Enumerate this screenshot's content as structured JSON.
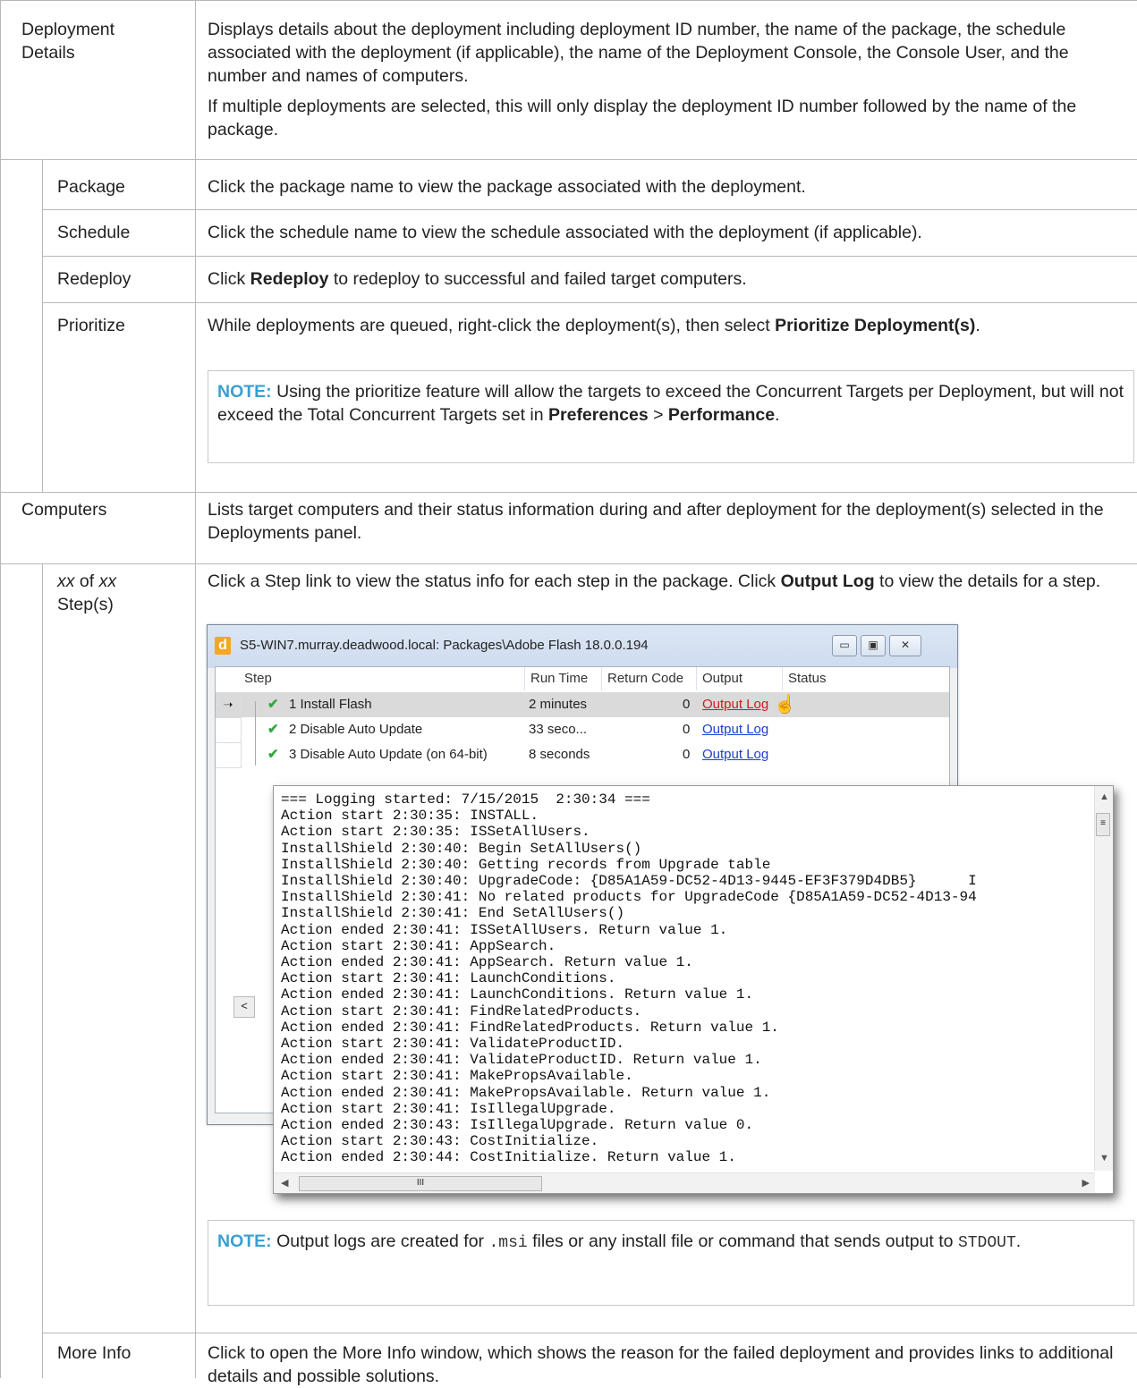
{
  "rows": {
    "deployment_details": {
      "label_line1": "Deployment",
      "label_line2": "Details",
      "para1": "Displays details about the deployment including deployment ID number, the name of the package, the schedule associated with the deployment (if applicable), the name of the Deployment Console, the Console User, and the number and names of computers.",
      "para2": "If multiple deployments are selected, this will only display the deployment ID number followed by the name of the package."
    },
    "package": {
      "label": "Package",
      "text": "Click the package name to view the package associated with the deployment."
    },
    "schedule": {
      "label": "Schedule",
      "text": "Click the schedule name to view the schedule associated with the deployment (if applicable)."
    },
    "redeploy": {
      "label": "Redeploy",
      "text_pre": "Click ",
      "text_bold": "Redeploy",
      "text_post": " to redeploy to successful and failed target computers."
    },
    "prioritize": {
      "label": "Prioritize",
      "text_pre": "While deployments are queued, right-click the deployment(s), then select ",
      "text_bold": "Prioritize Deployment(s)",
      "text_post": ".",
      "note_tag": "NOTE:",
      "note_text": " Using the prioritize feature will allow the targets to exceed the Concurrent Targets per Deployment, but will not exceed the Total Concurrent Targets set in ",
      "note_bold1": "Preferences",
      "note_sep": " > ",
      "note_bold2": "Performance",
      "note_end": "."
    },
    "computers": {
      "label": "Computers",
      "text": "Lists target computers and their status information during and after deployment for the deployment(s) selected in the Deployments panel."
    },
    "steps": {
      "label_xx1": "xx",
      "label_of": " of ",
      "label_xx2": "xx",
      "label_line2": "Step(s)",
      "text_pre": "Click a Step link to view the status info for each step in the package. Click ",
      "text_bold": "Output Log",
      "text_post": " to view the details for a step.",
      "note_tag": "NOTE:",
      "note_text1": " Output logs are created for ",
      "note_code1": ".msi",
      "note_text2": " files or any install file or command that sends output to ",
      "note_code2": "STDOUT",
      "note_end": "."
    },
    "more_info": {
      "label": "More Info",
      "text": "Click to open the More Info window, which shows the reason for the failed deployment and provides links to additional details and possible solutions."
    }
  },
  "window": {
    "title": "S5-WIN7.murray.deadwood.local: Packages\\Adobe Flash 18.0.0.194",
    "logo_letter": "d",
    "columns": [
      "Step",
      "Run Time",
      "Return Code",
      "Output",
      "Status"
    ],
    "steps": [
      {
        "name": "1 Install Flash",
        "run_time": "2 minutes",
        "return_code": "0",
        "output": "Output Log"
      },
      {
        "name": "2 Disable Auto Update",
        "run_time": "33 seco...",
        "return_code": "0",
        "output": "Output Log"
      },
      {
        "name": "3 Disable Auto Update (on 64-bit)",
        "run_time": "8 seconds",
        "return_code": "0",
        "output": "Output Log"
      }
    ]
  },
  "log": {
    "lines": [
      "=== Logging started: 7/15/2015  2:30:34 ===",
      "Action start 2:30:35: INSTALL.",
      "Action start 2:30:35: ISSetAllUsers.",
      "InstallShield 2:30:40: Begin SetAllUsers()",
      "InstallShield 2:30:40: Getting records from Upgrade table",
      "InstallShield 2:30:40: UpgradeCode: {D85A1A59-DC52-4D13-9445-EF3F379D4DB5}      I",
      "InstallShield 2:30:41: No related products for UpgradeCode {D85A1A59-DC52-4D13-94",
      "InstallShield 2:30:41: End SetAllUsers()",
      "Action ended 2:30:41: ISSetAllUsers. Return value 1.",
      "Action start 2:30:41: AppSearch.",
      "Action ended 2:30:41: AppSearch. Return value 1.",
      "Action start 2:30:41: LaunchConditions.",
      "Action ended 2:30:41: LaunchConditions. Return value 1.",
      "Action start 2:30:41: FindRelatedProducts.",
      "Action ended 2:30:41: FindRelatedProducts. Return value 1.",
      "Action start 2:30:41: ValidateProductID.",
      "Action ended 2:30:41: ValidateProductID. Return value 1.",
      "Action start 2:30:41: MakePropsAvailable.",
      "Action ended 2:30:41: MakePropsAvailable. Return value 1.",
      "Action start 2:30:41: IsIllegalUpgrade.",
      "Action ended 2:30:43: IsIllegalUpgrade. Return value 0.",
      "Action start 2:30:43: CostInitialize.",
      "Action ended 2:30:44: CostInitialize. Return value 1."
    ]
  }
}
